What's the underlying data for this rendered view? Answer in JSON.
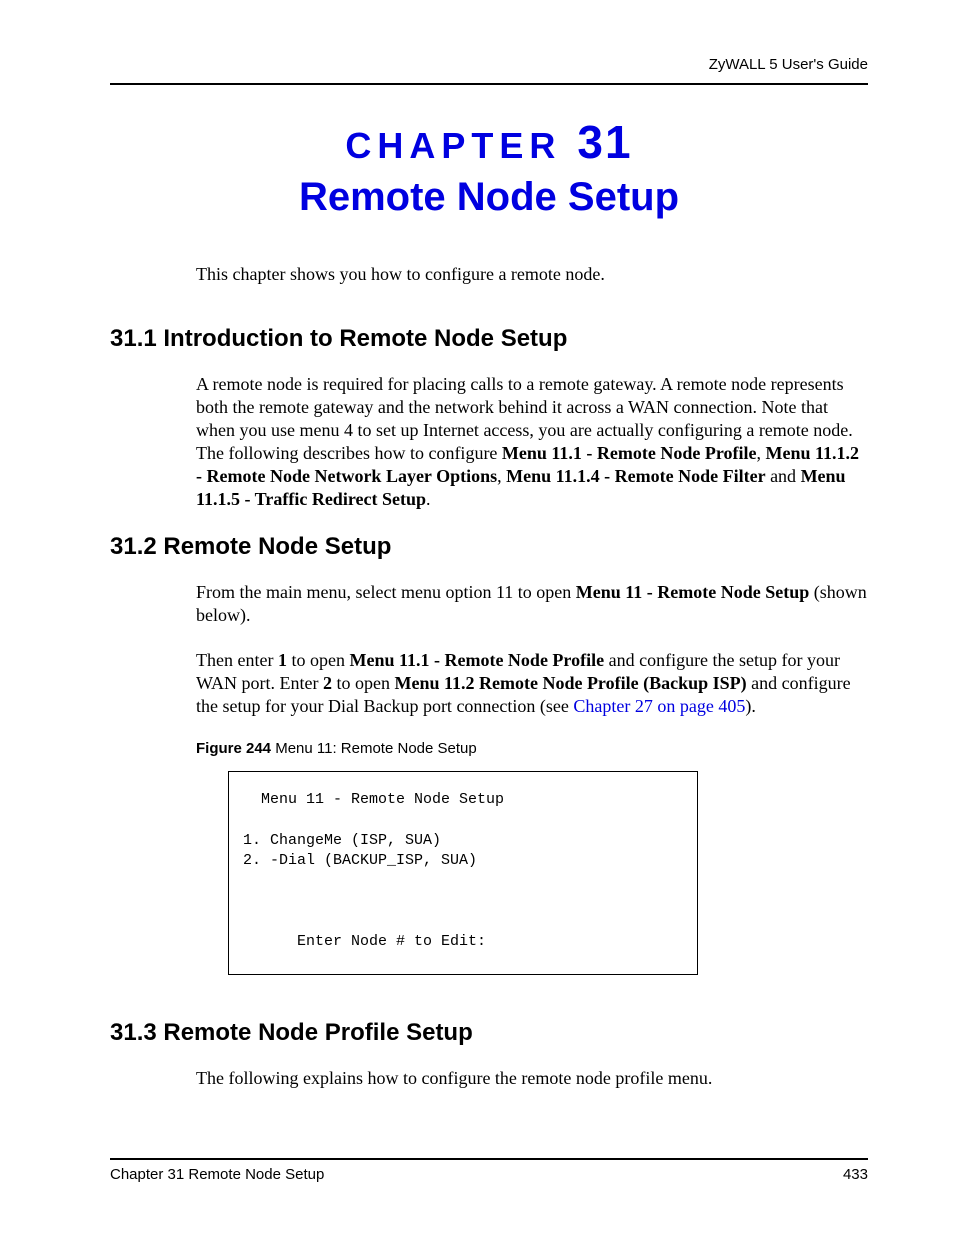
{
  "header": {
    "running_head": "ZyWALL 5 User's Guide"
  },
  "chapter": {
    "label_word": "CHAPTER",
    "label_number": "31",
    "title": "Remote Node Setup"
  },
  "intro_text": "This chapter shows you how to configure a remote node.",
  "sections": {
    "s1": {
      "heading": "31.1  Introduction to Remote Node Setup",
      "p1_a": "A remote node is required for placing calls to a remote gateway. A remote node represents both the remote gateway and the network behind it across a WAN connection. Note that when you use menu 4 to set up Internet access, you are actually configuring a remote node. The following describes how to configure ",
      "p1_b1": "Menu 11.1 - Remote Node Profile",
      "p1_c": ", ",
      "p1_b2": "Menu 11.1.2 - Remote Node Network Layer Options",
      "p1_d": ", ",
      "p1_b3": "Menu 11.1.4 - Remote Node Filter",
      "p1_e": " and ",
      "p1_b4": "Menu 11.1.5 - Traffic Redirect Setup",
      "p1_f": "."
    },
    "s2": {
      "heading": "31.2  Remote Node Setup",
      "p1_a": "From the main menu, select menu option 11 to open ",
      "p1_b1": "Menu 11 - Remote Node Setup",
      "p1_c": " (shown below).",
      "p2_a": "Then enter ",
      "p2_b1": "1",
      "p2_c": " to open ",
      "p2_b2": "Menu 11.1 - Remote Node Profile",
      "p2_d": " and configure the setup for your WAN port. Enter ",
      "p2_b3": "2",
      "p2_e": " to open ",
      "p2_b4": "Menu 11.2 Remote Node Profile (Backup ISP)",
      "p2_f": " and configure the setup for your Dial Backup port connection (see ",
      "p2_link": "Chapter 27 on page 405",
      "p2_g": ")."
    },
    "s3": {
      "heading": "31.3  Remote Node Profile Setup",
      "p1": "The following explains how to configure the remote node profile menu."
    }
  },
  "figure": {
    "caption_bold": "Figure 244",
    "caption_rest": "   Menu 11: Remote Node Setup",
    "box_text": "  Menu 11 - Remote Node Setup\n\n1. ChangeMe (ISP, SUA)\n2. -Dial (BACKUP_ISP, SUA)\n\n\n\n      Enter Node # to Edit:"
  },
  "footer": {
    "left": "Chapter 31 Remote Node Setup",
    "right": "433"
  }
}
